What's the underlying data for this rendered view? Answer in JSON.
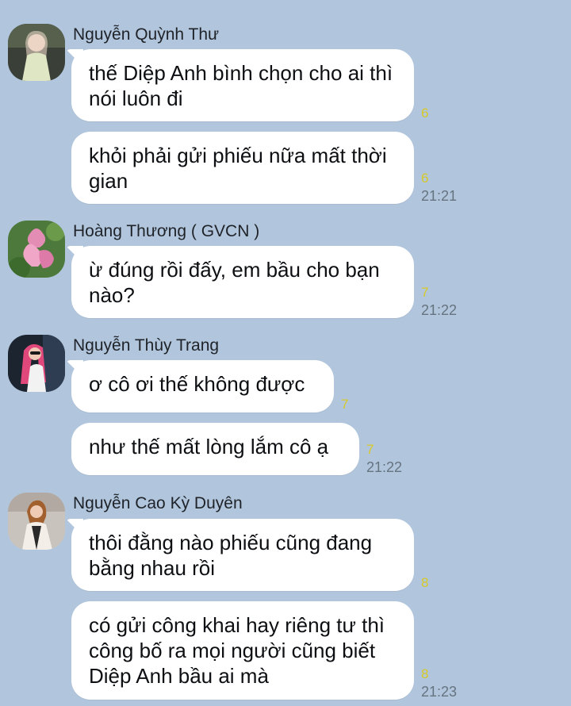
{
  "messages": [
    {
      "sender": "Nguyễn Quỳnh Thư",
      "bubbles": [
        {
          "text": "thế Diệp Anh bình chọn cho ai thì nói luôn đi",
          "seen": "6"
        },
        {
          "text": "khỏi phải gửi phiếu nữa mất thời gian",
          "seen": "6",
          "time": "21:21"
        }
      ]
    },
    {
      "sender": "Hoàng Thương ( GVCN )",
      "bubbles": [
        {
          "text": "ừ đúng rồi đấy, em bầu cho bạn nào?",
          "seen": "7",
          "time": "21:22"
        }
      ]
    },
    {
      "sender": "Nguyễn Thùy Trang",
      "bubbles": [
        {
          "text": "ơ cô ơi thế không được",
          "seen": "7"
        },
        {
          "text": "như thế mất lòng lắm cô ạ",
          "seen": "7",
          "time": "21:22"
        }
      ]
    },
    {
      "sender": "Nguyễn Cao Kỳ Duyên",
      "bubbles": [
        {
          "text": "thôi đằng nào phiếu cũng đang bằng nhau rồi",
          "seen": "8"
        },
        {
          "text": "có gửi công khai hay riêng tư thì công bố ra mọi người cũng biết Diệp Anh bầu ai mà",
          "seen": "8",
          "time": "21:23"
        }
      ]
    }
  ],
  "colors": {
    "background": "#b1c6dc",
    "bubble": "#ffffff",
    "seen": "#d7c928",
    "time": "#667380"
  }
}
